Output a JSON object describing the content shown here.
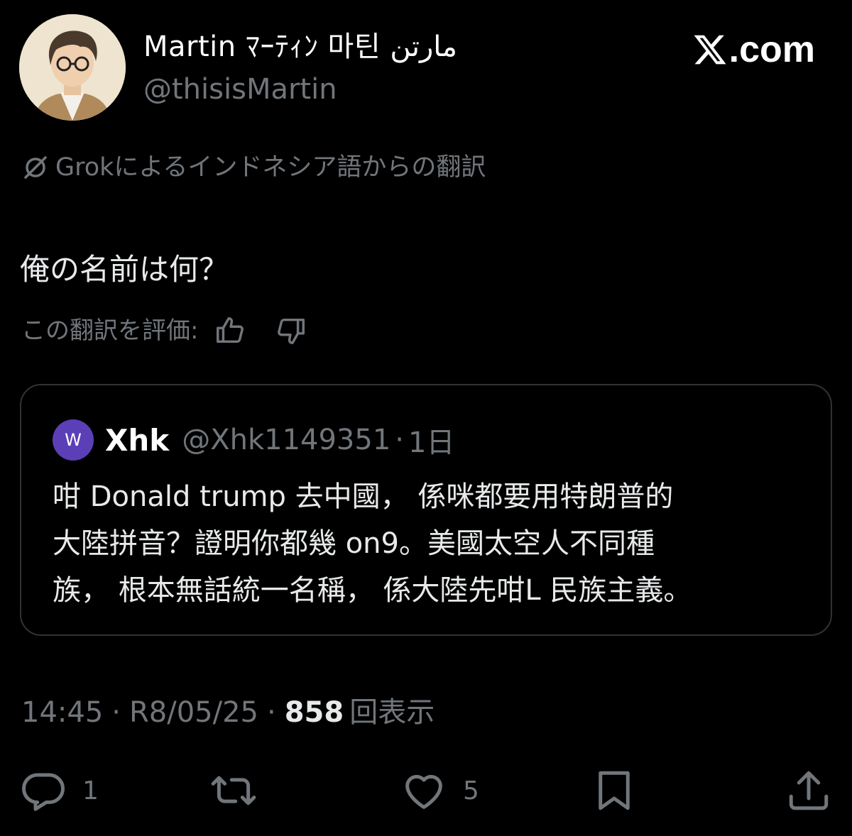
{
  "author": {
    "display_name": "Martin ﾏｰﾃｨﾝ 마틴 مارتن",
    "handle": "@thisisMartin"
  },
  "brand": {
    "text": ".com",
    "logo_icon": "x-logo-icon"
  },
  "translation": {
    "note": "Grokによるインドネシア語からの翻訳",
    "icon": "grok-icon"
  },
  "post": {
    "text": "俺の名前は何？"
  },
  "rating": {
    "label": "この翻訳を評価:",
    "thumbs_up_icon": "thumbs-up-icon",
    "thumbs_down_icon": "thumbs-down-icon"
  },
  "quote": {
    "avatar_letter": "W",
    "avatar_color": "#5b3fb6",
    "name": "Xhk",
    "handle": "@Xhk1149351",
    "separator": "·",
    "time": "1日",
    "lines": [
      "咁 Donald trump 去中國， 係咪都要用特朗普的",
      "大陸拼音？證明你都幾 on9。美國太空人不同種",
      "族， 根本無話統一名稱， 係大陸先咁L 民族主義。"
    ]
  },
  "meta": {
    "time": "14:45",
    "dot1": "·",
    "date": "R8/05/25",
    "dot2": "·",
    "views_count": "858",
    "views_label": "回表示"
  },
  "actions": {
    "reply_count": "1",
    "like_count": "5"
  },
  "colors": {
    "background": "#000000",
    "text": "#e7e9ea",
    "muted": "#71767b",
    "border": "#2f3336"
  }
}
